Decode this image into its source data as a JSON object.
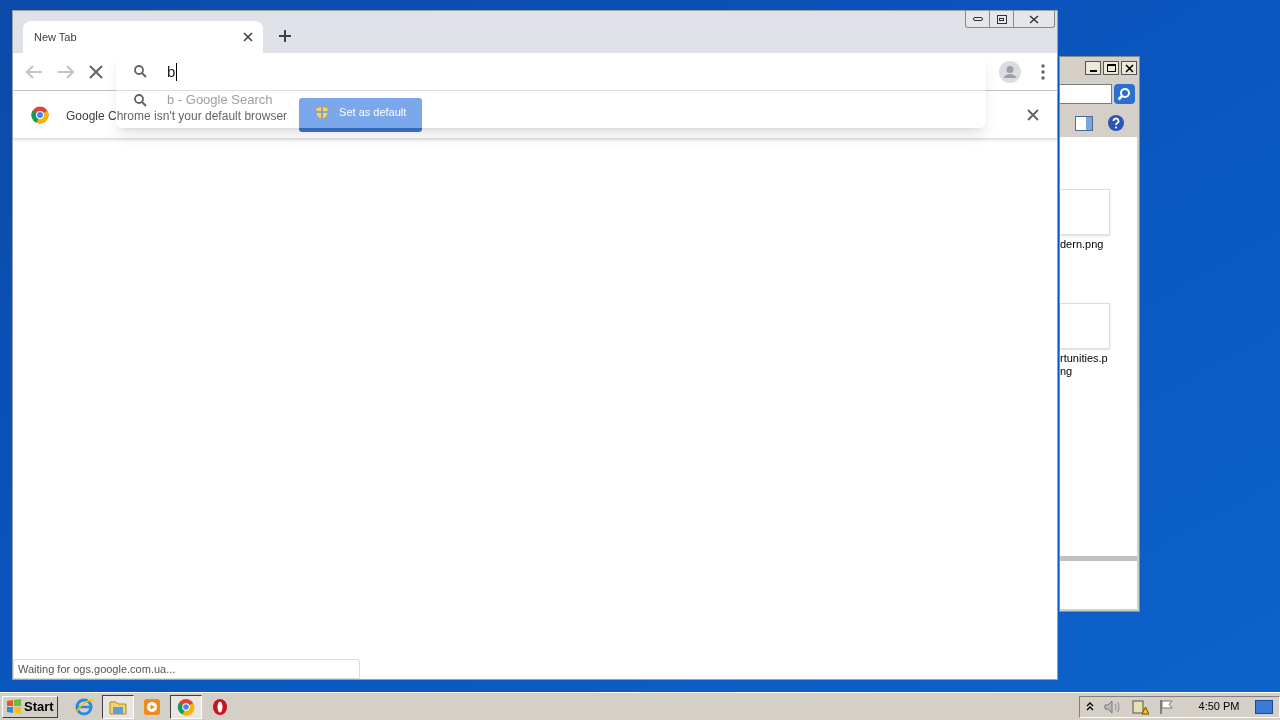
{
  "explorer": {
    "files": [
      {
        "lines": [
          "dern.png"
        ]
      },
      {
        "lines": [
          "rtunities.p",
          "ng"
        ]
      }
    ]
  },
  "browser": {
    "tabs": [
      {
        "title": "New Tab",
        "selected": true
      }
    ],
    "omnibox": {
      "value": "b"
    },
    "suggestions": [
      {
        "text": "b - Google Search"
      }
    ],
    "infobar": {
      "message": "Google Chrome isn't your default browser",
      "button": "Set as default"
    },
    "status": "Waiting for ogs.google.com.ua..."
  },
  "taskbar": {
    "start": "Start",
    "apps": [
      {
        "kind": "ie",
        "selected": false
      },
      {
        "kind": "folder",
        "selected": true
      },
      {
        "kind": "media",
        "selected": false
      },
      {
        "kind": "chrome",
        "selected": true
      },
      {
        "kind": "opera",
        "selected": false
      }
    ],
    "clock": "4:50 PM"
  }
}
